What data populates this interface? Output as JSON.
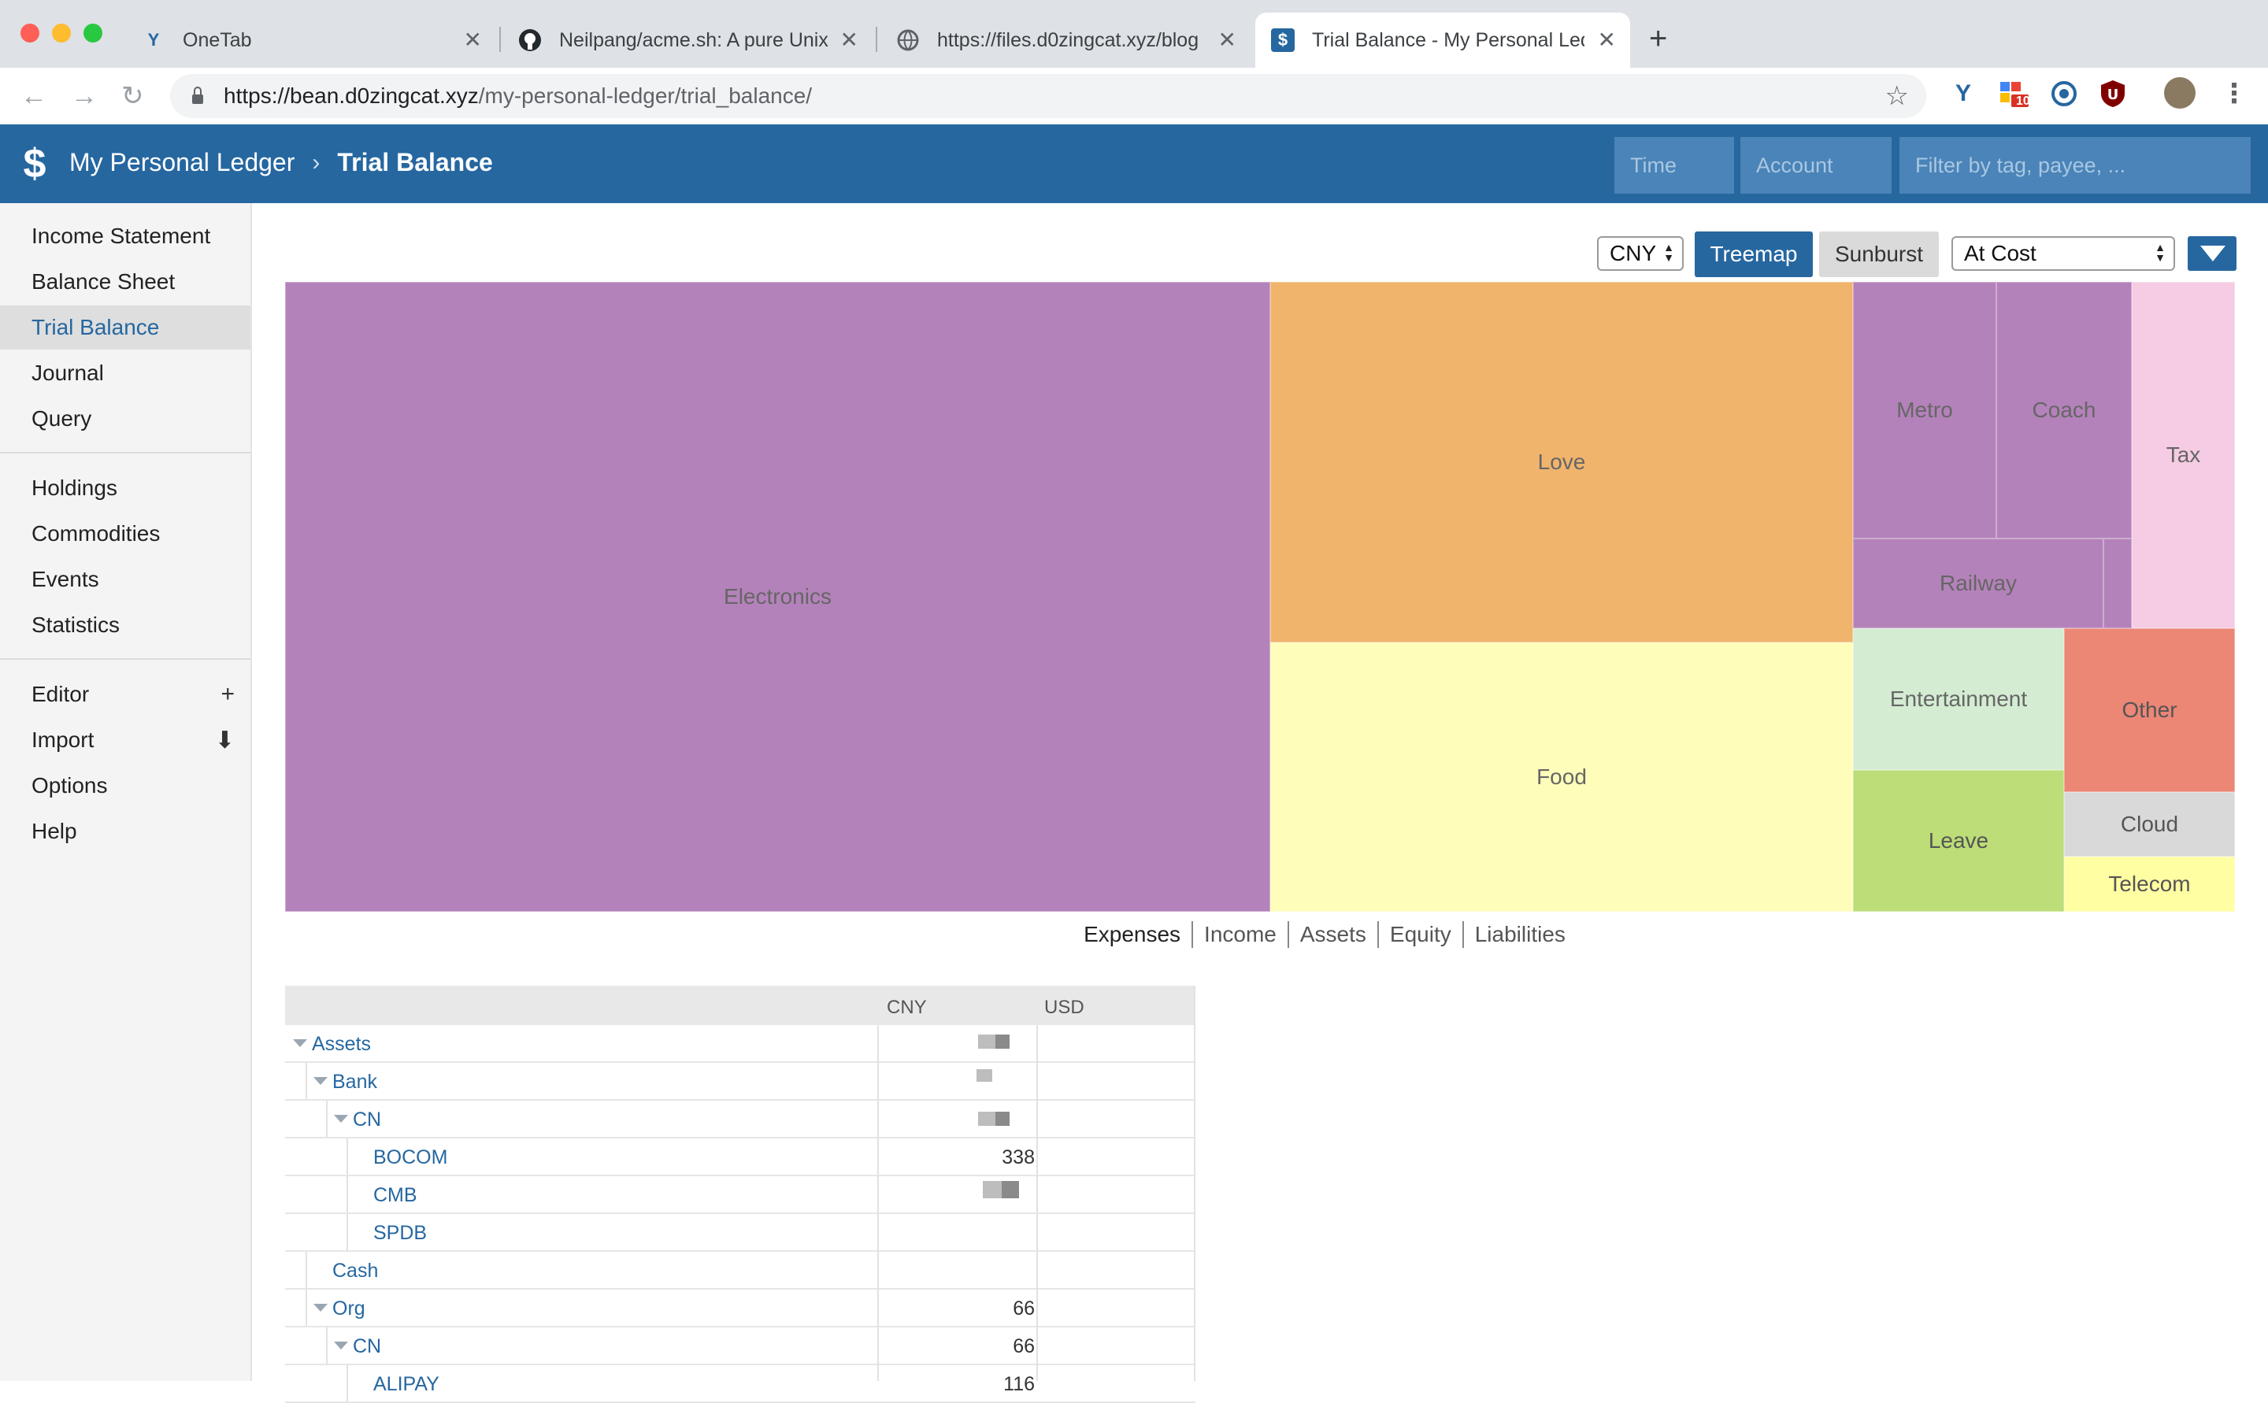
{
  "browser": {
    "tabs": [
      {
        "title": "OneTab",
        "icon": "onetab-icon"
      },
      {
        "title": "Neilpang/acme.sh: A pure Unix",
        "icon": "github-icon"
      },
      {
        "title": "https://files.d0zingcat.xyz/blog",
        "icon": "globe-icon"
      },
      {
        "title": "Trial Balance - My Personal Led",
        "icon": "dollar-icon"
      }
    ],
    "url_host": "https://bean.d0zingcat.xyz",
    "url_path": "/my-personal-ledger/trial_balance/",
    "extension_badge": "10"
  },
  "app": {
    "ledger_name": "My Personal Ledger",
    "page_title": "Trial Balance",
    "filters": {
      "time": "Time",
      "account": "Account",
      "tag": "Filter by tag, payee, ..."
    }
  },
  "sidebar": {
    "group1": [
      "Income Statement",
      "Balance Sheet",
      "Trial Balance",
      "Journal",
      "Query"
    ],
    "group2": [
      "Holdings",
      "Commodities",
      "Events",
      "Statistics"
    ],
    "group3": [
      "Editor",
      "Import",
      "Options",
      "Help"
    ],
    "active": "Trial Balance"
  },
  "controls": {
    "currency": "CNY",
    "chart_modes": [
      "Treemap",
      "Sunburst"
    ],
    "active_mode": "Treemap",
    "conversion": "At Cost"
  },
  "treemap": {
    "colors": {
      "purple": "#b482ba",
      "orange": "#f1b46d",
      "yellow": "#fffdba",
      "pink": "#f5cce4",
      "lightgreen": "#d3ecd2",
      "green": "#bcdd77",
      "salmon": "#ec8675",
      "grey": "#d9d9d9",
      "paleyellow": "#fffea3"
    },
    "labels": [
      "Electronics",
      "Love",
      "Food",
      "Metro",
      "Coach",
      "Railway",
      "Tax",
      "Entertainment",
      "Other",
      "Leave",
      "Cloud",
      "Telecom"
    ]
  },
  "account_types": [
    "Expenses",
    "Income",
    "Assets",
    "Equity",
    "Liabilities"
  ],
  "table": {
    "columns": [
      "CNY",
      "USD"
    ],
    "rows": [
      {
        "name": "Assets",
        "depth": 0,
        "expanded": true,
        "cny": ""
      },
      {
        "name": "Bank",
        "depth": 1,
        "expanded": true,
        "cny": ""
      },
      {
        "name": "CN",
        "depth": 2,
        "expanded": true,
        "cny": ""
      },
      {
        "name": "BOCOM",
        "depth": 3,
        "expanded": false,
        "cny": "338"
      },
      {
        "name": "CMB",
        "depth": 3,
        "expanded": false,
        "cny": ""
      },
      {
        "name": "SPDB",
        "depth": 3,
        "expanded": false,
        "cny": ""
      },
      {
        "name": "Cash",
        "depth": 1,
        "expanded": false,
        "cny": ""
      },
      {
        "name": "Org",
        "depth": 1,
        "expanded": true,
        "cny": "66"
      },
      {
        "name": "CN",
        "depth": 2,
        "expanded": true,
        "cny": "66"
      },
      {
        "name": "ALIPAY",
        "depth": 3,
        "expanded": false,
        "cny": "116"
      }
    ]
  }
}
